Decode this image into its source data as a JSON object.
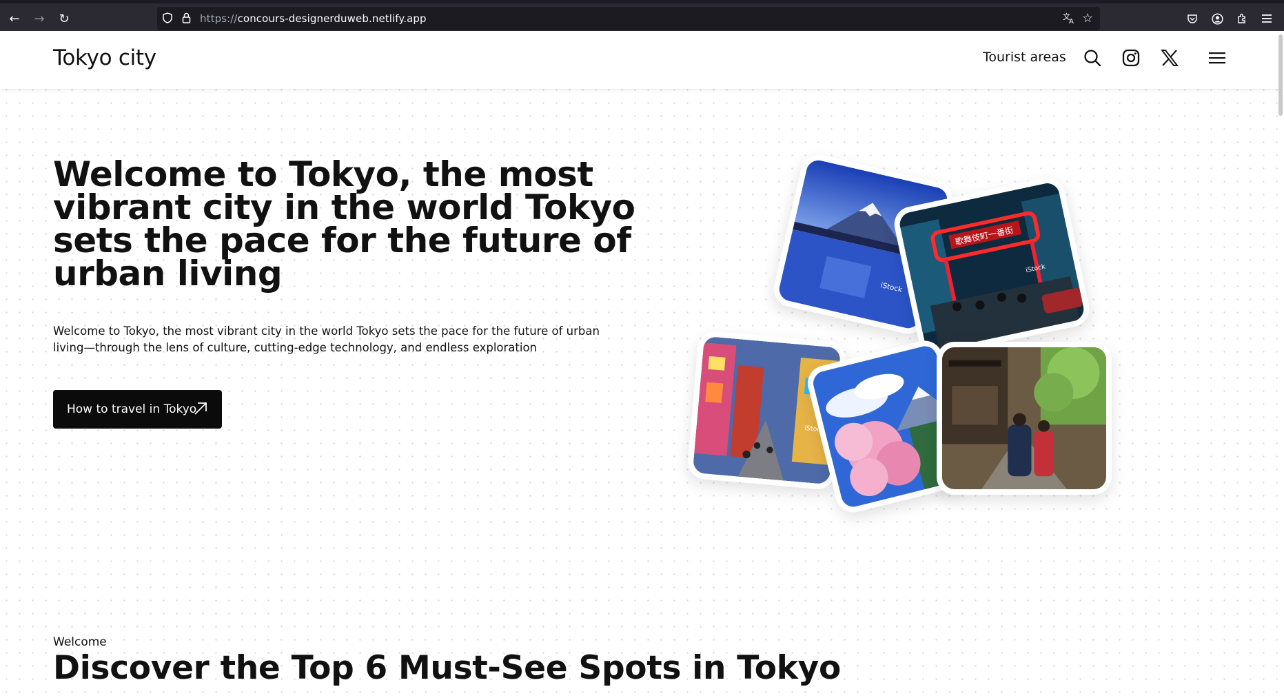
{
  "browser": {
    "url_scheme": "https://",
    "url_host": "concours-designerduweb.netlify.app"
  },
  "header": {
    "logo": "Tokyo city",
    "nav_link": "Tourist areas",
    "icons": [
      "search-icon",
      "instagram-icon",
      "x-twitter-icon",
      "menu-icon"
    ]
  },
  "hero": {
    "title": "Welcome to Tokyo, the most vibrant city in the world Tokyo sets the pace for the future of urban living",
    "subtitle": "Welcome to Tokyo, the most vibrant city in the world Tokyo sets the pace for the future of urban living—through the lens of culture, cutting-edge technology, and endless exploration",
    "cta_label": "How to travel in Tokyo"
  },
  "gallery": {
    "photos": [
      "mount-fuji-lake",
      "kabukicho-neon-gate",
      "shinjuku-street",
      "cherry-blossom-fuji",
      "kyoto-kimono-street"
    ],
    "watermark": "iStock",
    "gate_sign": "歌舞伎町一番街"
  },
  "section": {
    "label": "Welcome",
    "title": "Discover the Top 6 Must-See Spots in Tokyo"
  },
  "colors": {
    "chrome_bg": "#2b2a33",
    "url_bg": "#1c1b22",
    "cta_bg": "#0b0b0b",
    "text": "#111111"
  }
}
